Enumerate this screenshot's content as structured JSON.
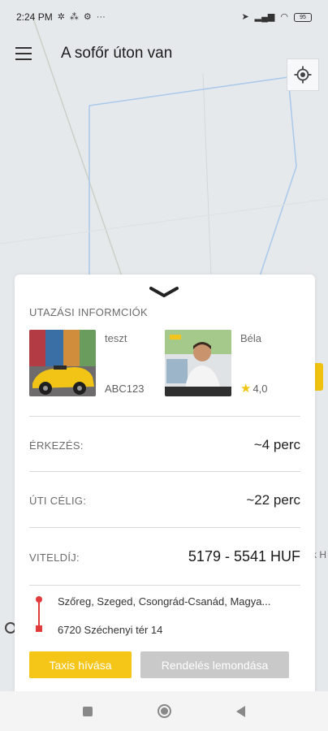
{
  "status_bar": {
    "time": "2:24 PM",
    "left_icons": [
      "settings-icon",
      "network-icon",
      "gear-icon",
      "more-icon"
    ],
    "right_icons": [
      "location-icon",
      "signal-icon",
      "wifi-icon",
      "battery-icon"
    ],
    "battery_level": "95"
  },
  "header": {
    "title": "A sofőr úton van"
  },
  "map": {
    "edge_text": "k H"
  },
  "trip_card": {
    "section_title": "UTAZÁSI INFORMCIÓK",
    "car": {
      "name": "teszt",
      "plate": "ABC123"
    },
    "driver": {
      "name": "Béla",
      "rating": "4,0"
    },
    "arrival": {
      "label": "ÉRKEZÉS:",
      "value": "~4 perc"
    },
    "to_destination": {
      "label": "ÚTI CÉLIG:",
      "value": "~22 perc"
    },
    "fare": {
      "label": "VITELDÍJ:",
      "value": "5179 - 5541 HUF"
    },
    "route": {
      "from": "Szőreg, Szeged, Csongrád-Csanád, Magya...",
      "to": "6720 Széchenyi tér 14"
    },
    "buttons": {
      "call": "Taxis hívása",
      "cancel": "Rendelés lemondása"
    }
  },
  "colors": {
    "accent": "#f5c518",
    "route": "#e03a3a",
    "disabled_button": "#c9c9c9",
    "map_background": "#e6e9ec"
  }
}
